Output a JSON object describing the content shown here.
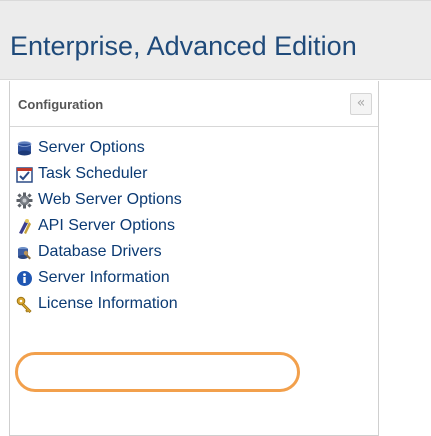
{
  "header": {
    "title": "Enterprise, Advanced Edition"
  },
  "panel": {
    "title": "Configuration",
    "collapse_symbol": "«",
    "items": [
      {
        "label": "Server Options",
        "icon": "server-icon"
      },
      {
        "label": "Task Scheduler",
        "icon": "task-scheduler-icon"
      },
      {
        "label": "Web Server Options",
        "icon": "web-server-icon"
      },
      {
        "label": "API Server Options",
        "icon": "api-server-icon"
      },
      {
        "label": "Database Drivers",
        "icon": "database-drivers-icon",
        "highlighted": true
      },
      {
        "label": "Server Information",
        "icon": "info-icon"
      },
      {
        "label": "License Information",
        "icon": "key-icon"
      }
    ]
  },
  "colors": {
    "title": "#1f4a7a",
    "link": "#0b3a73",
    "highlight": "#f2a04c",
    "header_bg": "#ececec"
  }
}
